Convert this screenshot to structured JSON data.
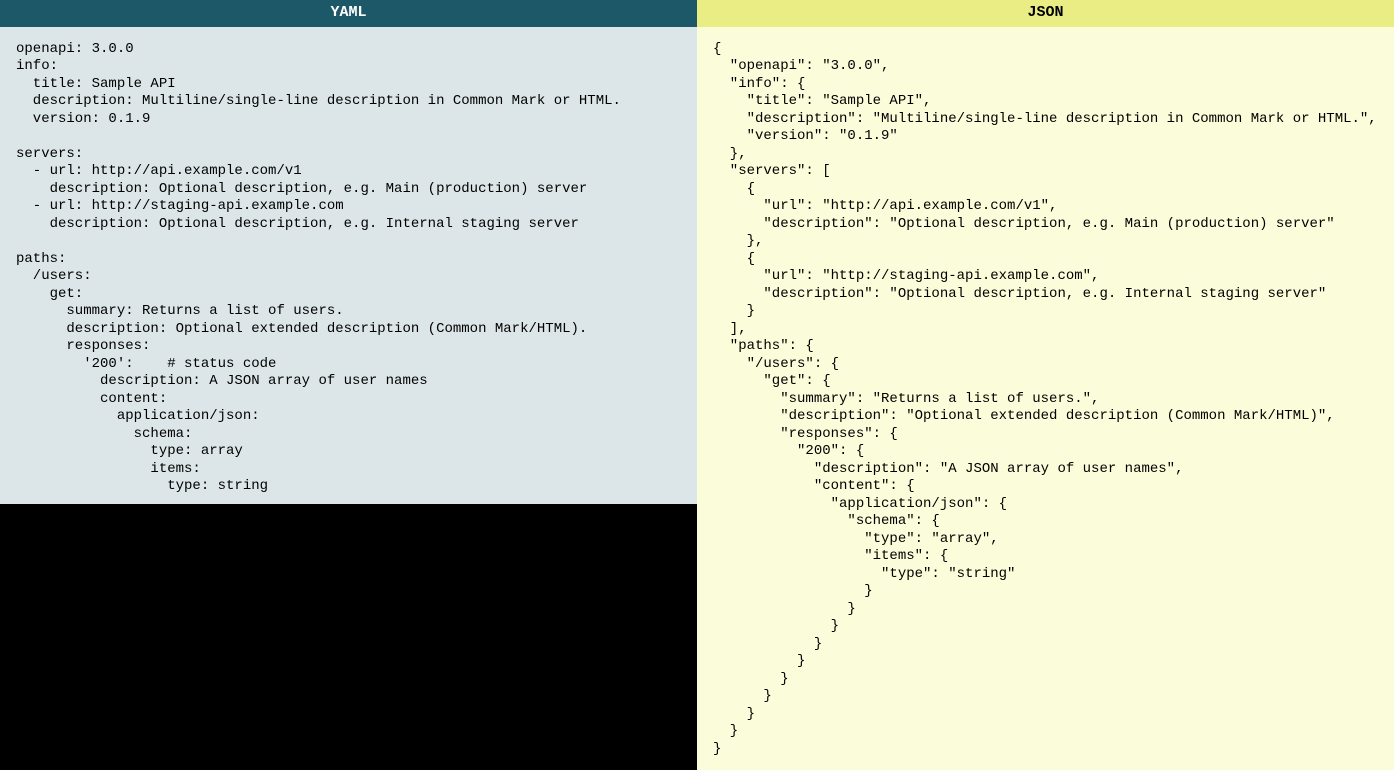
{
  "yaml": {
    "header": "YAML",
    "content": "openapi: 3.0.0\ninfo:\n  title: Sample API\n  description: Multiline/single-line description in Common Mark or HTML.\n  version: 0.1.9\n\nservers:\n  - url: http://api.example.com/v1\n    description: Optional description, e.g. Main (production) server\n  - url: http://staging-api.example.com\n    description: Optional description, e.g. Internal staging server\n\npaths:\n  /users:\n    get:\n      summary: Returns a list of users.\n      description: Optional extended description (Common Mark/HTML).\n      responses:\n        '200':    # status code\n          description: A JSON array of user names\n          content:\n            application/json:\n              schema:\n                type: array\n                items:\n                  type: string"
  },
  "json": {
    "header": "JSON",
    "content": "{\n  \"openapi\": \"3.0.0\",\n  \"info\": {\n    \"title\": \"Sample API\",\n    \"description\": \"Multiline/single-line description in Common Mark or HTML.\",\n    \"version\": \"0.1.9\"\n  },\n  \"servers\": [\n    {\n      \"url\": \"http://api.example.com/v1\",\n      \"description\": \"Optional description, e.g. Main (production) server\"\n    },\n    {\n      \"url\": \"http://staging-api.example.com\",\n      \"description\": \"Optional description, e.g. Internal staging server\"\n    }\n  ],\n  \"paths\": {\n    \"/users\": {\n      \"get\": {\n        \"summary\": \"Returns a list of users.\",\n        \"description\": \"Optional extended description (Common Mark/HTML)\",\n        \"responses\": {\n          \"200\": {\n            \"description\": \"A JSON array of user names\",\n            \"content\": {\n              \"application/json\": {\n                \"schema\": {\n                  \"type\": \"array\",\n                  \"items\": {\n                    \"type\": \"string\"\n                  }\n                }\n              }\n            }\n          }\n        }\n      }\n    }\n  }\n}"
  }
}
